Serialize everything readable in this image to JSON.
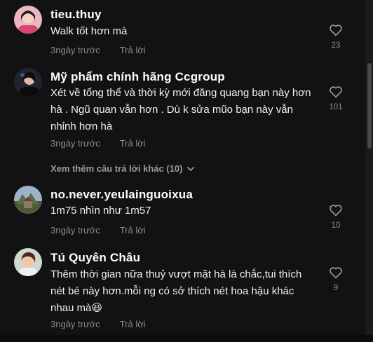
{
  "comments": [
    {
      "username": "tieu.thuy",
      "text": "Walk tốt hơn mà",
      "time": "3ngày trước",
      "reply": "Trả lời",
      "likes": "23",
      "avatar": "avatar-photo-girl-pink"
    },
    {
      "username": "Mỹ phẩm chính hãng Ccgroup",
      "text": "Xét về tổng thể và thời kỳ mới đăng quang bạn này hơn hà . Ngũ quan vẫn hơn . Dù k sửa mũo bạn này vẫn nhỉnh hơn hà",
      "time": "3ngày trước",
      "reply": "Trả lời",
      "likes": "101",
      "avatar": "avatar-photo-woman-dark"
    },
    {
      "username": "no.never.yeulainguoixua",
      "text": "1m75 nhìn như 1m57",
      "time": "3ngày trước",
      "reply": "Trả lời",
      "likes": "10",
      "avatar": "avatar-photo-landscape"
    },
    {
      "username": "Tú Quyên Châu",
      "text": "Thêm thời gian nữa thuỷ vượt mặt hà là chắc,tui thích nét bé này hơn.mỗi ng có sở thích nét hoa hậu khác nhau mà😆",
      "time": "3ngày trước",
      "reply": "Trả lời",
      "likes": "9",
      "avatar": "avatar-photo-woman-outdoor"
    }
  ],
  "more_replies": {
    "label": "Xem thêm câu trả lời khác (10)",
    "icon": "chevron-down-icon"
  },
  "colors": {
    "background": "#121212",
    "text": "#ffffff",
    "muted": "#8a8a8a"
  }
}
